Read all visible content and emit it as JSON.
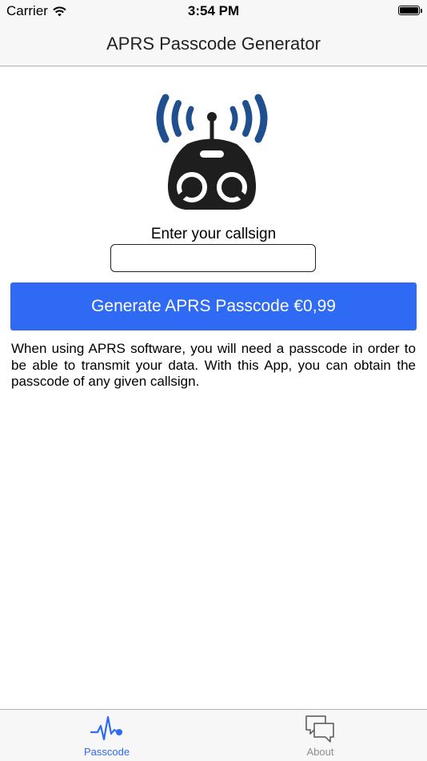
{
  "status_bar": {
    "carrier": "Carrier",
    "time": "3:54 PM"
  },
  "nav": {
    "title": "APRS Passcode Generator"
  },
  "form": {
    "prompt": "Enter your callsign",
    "callsign_value": "",
    "button_label": "Generate APRS Passcode €0,99"
  },
  "description": "When using APRS software, you will need a passcode in order to be able to transmit your data. With this App, you can obtain the passcode of any given callsign.",
  "tabs": [
    {
      "label": "Passcode",
      "icon": "heartbeat-icon",
      "active": true
    },
    {
      "label": "About",
      "icon": "chat-bubbles-icon",
      "active": false
    }
  ],
  "colors": {
    "accent": "#2f6af4",
    "logo_blue": "#1f4f8f",
    "logo_dark": "#1e1e1e"
  }
}
